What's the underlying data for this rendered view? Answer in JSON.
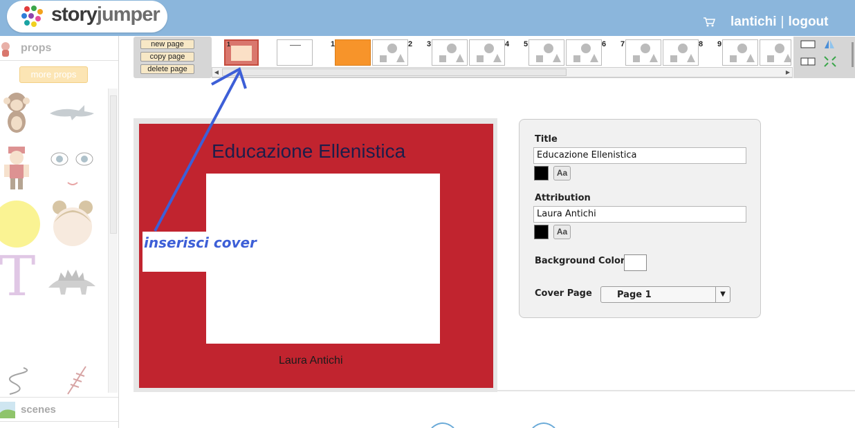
{
  "header": {
    "logo_word1": "story",
    "logo_word2": "jumper",
    "username": "lantichi",
    "separator": "|",
    "logout_label": "logout",
    "background_color": "#8bb6dc"
  },
  "sidebar": {
    "props_label": "props",
    "more_props_label": "more props",
    "scenes_label": "scenes",
    "props": [
      {
        "name": "monkey"
      },
      {
        "name": "shark"
      },
      {
        "name": "pirate"
      },
      {
        "name": "cartoon-eyes"
      },
      {
        "name": "sun"
      },
      {
        "name": "girl-head"
      },
      {
        "name": "letter-t",
        "text": "T"
      },
      {
        "name": "stegosaurus"
      },
      {
        "name": "squiggle"
      },
      {
        "name": "stitches"
      }
    ]
  },
  "page_tools": {
    "new_page_label": "new page",
    "copy_page_label": "copy page",
    "delete_page_label": "delete page"
  },
  "page_strip": {
    "cover_number": "1",
    "page_numbers": [
      "1",
      "2",
      "3",
      "4",
      "5",
      "6",
      "7",
      "8",
      "9"
    ]
  },
  "cover": {
    "title": "Educazione Ellenistica",
    "author": "Laura Antichi",
    "background_color": "#c1242f"
  },
  "annotation": {
    "text": "inserisci cover",
    "color": "#3d5fd7"
  },
  "properties": {
    "title_label": "Title",
    "title_value": "Educazione Ellenistica",
    "attribution_label": "Attribution",
    "attribution_value": "Laura Antichi",
    "font_button_label": "Aa",
    "background_color_label": "Background Color",
    "cover_page_label": "Cover Page",
    "cover_page_value": "Page 1"
  }
}
